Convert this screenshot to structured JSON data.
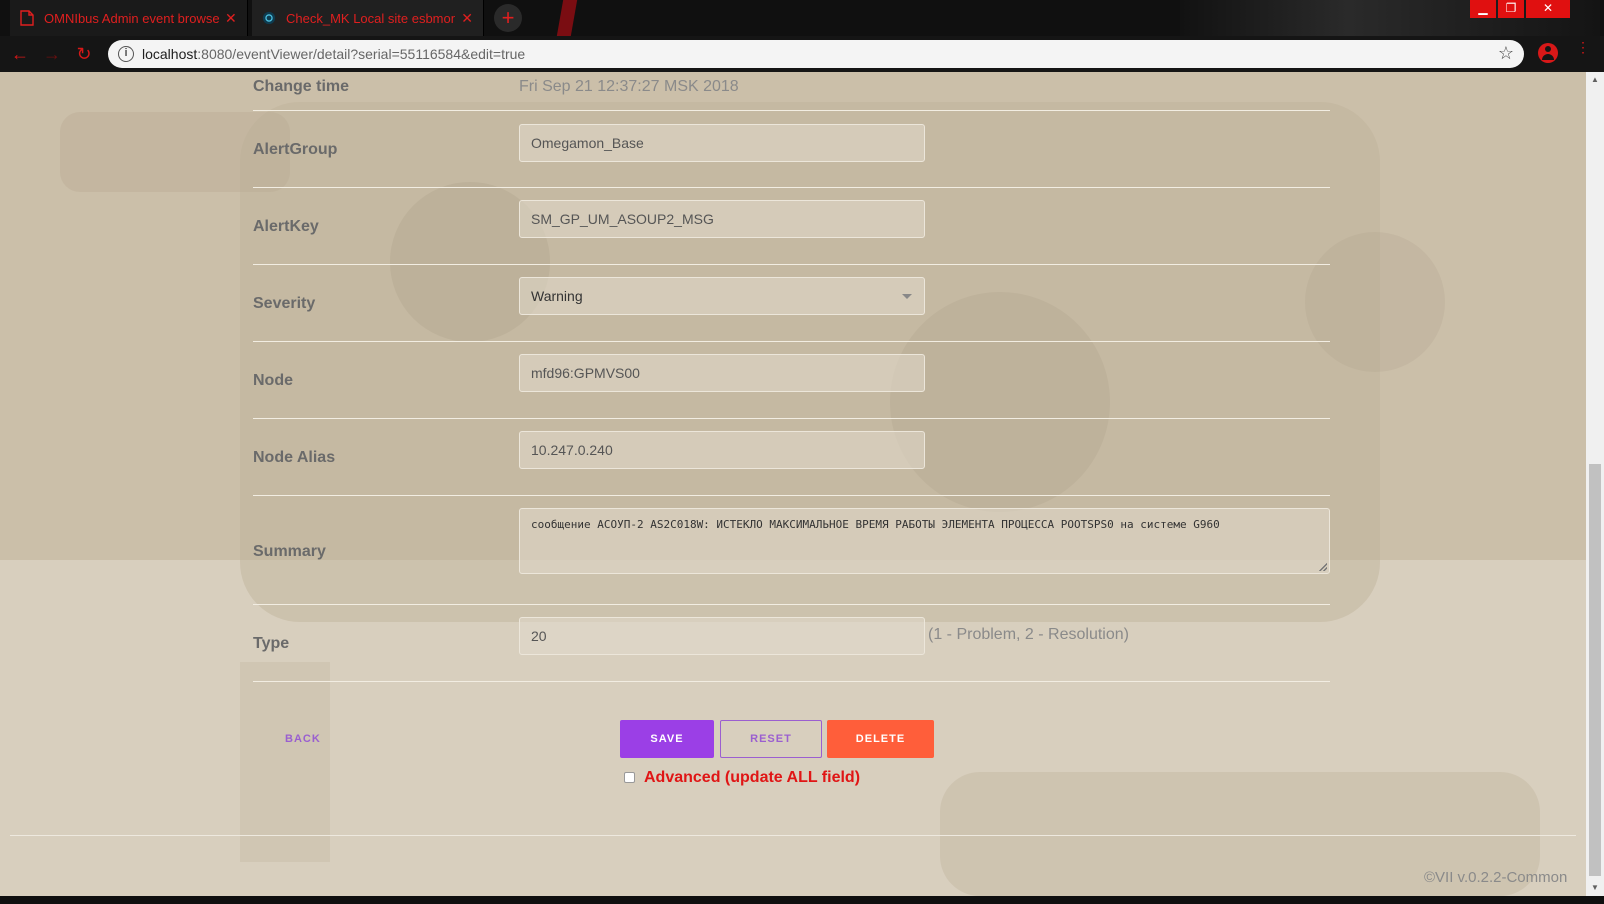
{
  "browser": {
    "tabs": [
      {
        "title": "OMNIbus Admin event browser",
        "active": false
      },
      {
        "title": "Check_MK Local site esbmon",
        "active": true
      }
    ],
    "new_tab_icon": "+",
    "window_buttons": {
      "minimize": "▁",
      "restore": "❐",
      "close": "✕"
    },
    "url_host": "localhost",
    "url_path": ":8080/eventViewer/detail?serial=55116584&edit=true",
    "accent_color": "#e01f1f"
  },
  "form": {
    "change_time": {
      "label": "Change time",
      "value": "Fri Sep 21 12:37:27 MSK 2018"
    },
    "alert_group": {
      "label": "AlertGroup",
      "value": "Omegamon_Base"
    },
    "alert_key": {
      "label": "AlertKey",
      "value": "SM_GP_UM_ASOUP2_MSG"
    },
    "severity": {
      "label": "Severity",
      "value": "Warning"
    },
    "node": {
      "label": "Node",
      "value": "mfd96:GPMVS00"
    },
    "node_alias": {
      "label": "Node Alias",
      "value": "10.247.0.240"
    },
    "summary": {
      "label": "Summary",
      "value": "сообщение АСОУП-2 AS2C018W: ИСТЕКЛО МАКСИМАЛЬНОЕ ВРЕМЯ РАБОТЫ ЭЛЕМЕНТА ПРОЦЕССА POOTSPS0 на системе G960"
    },
    "type": {
      "label": "Type",
      "value": "20",
      "hint": "(1 - Problem, 2 - Resolution)"
    }
  },
  "actions": {
    "back": "BACK",
    "save": "SAVE",
    "reset": "RESET",
    "delete": "DELETE",
    "advanced_label": "Advanced (update ALL field)",
    "advanced_checked": false
  },
  "footer": {
    "version": "©VII v.0.2.2-Common"
  }
}
